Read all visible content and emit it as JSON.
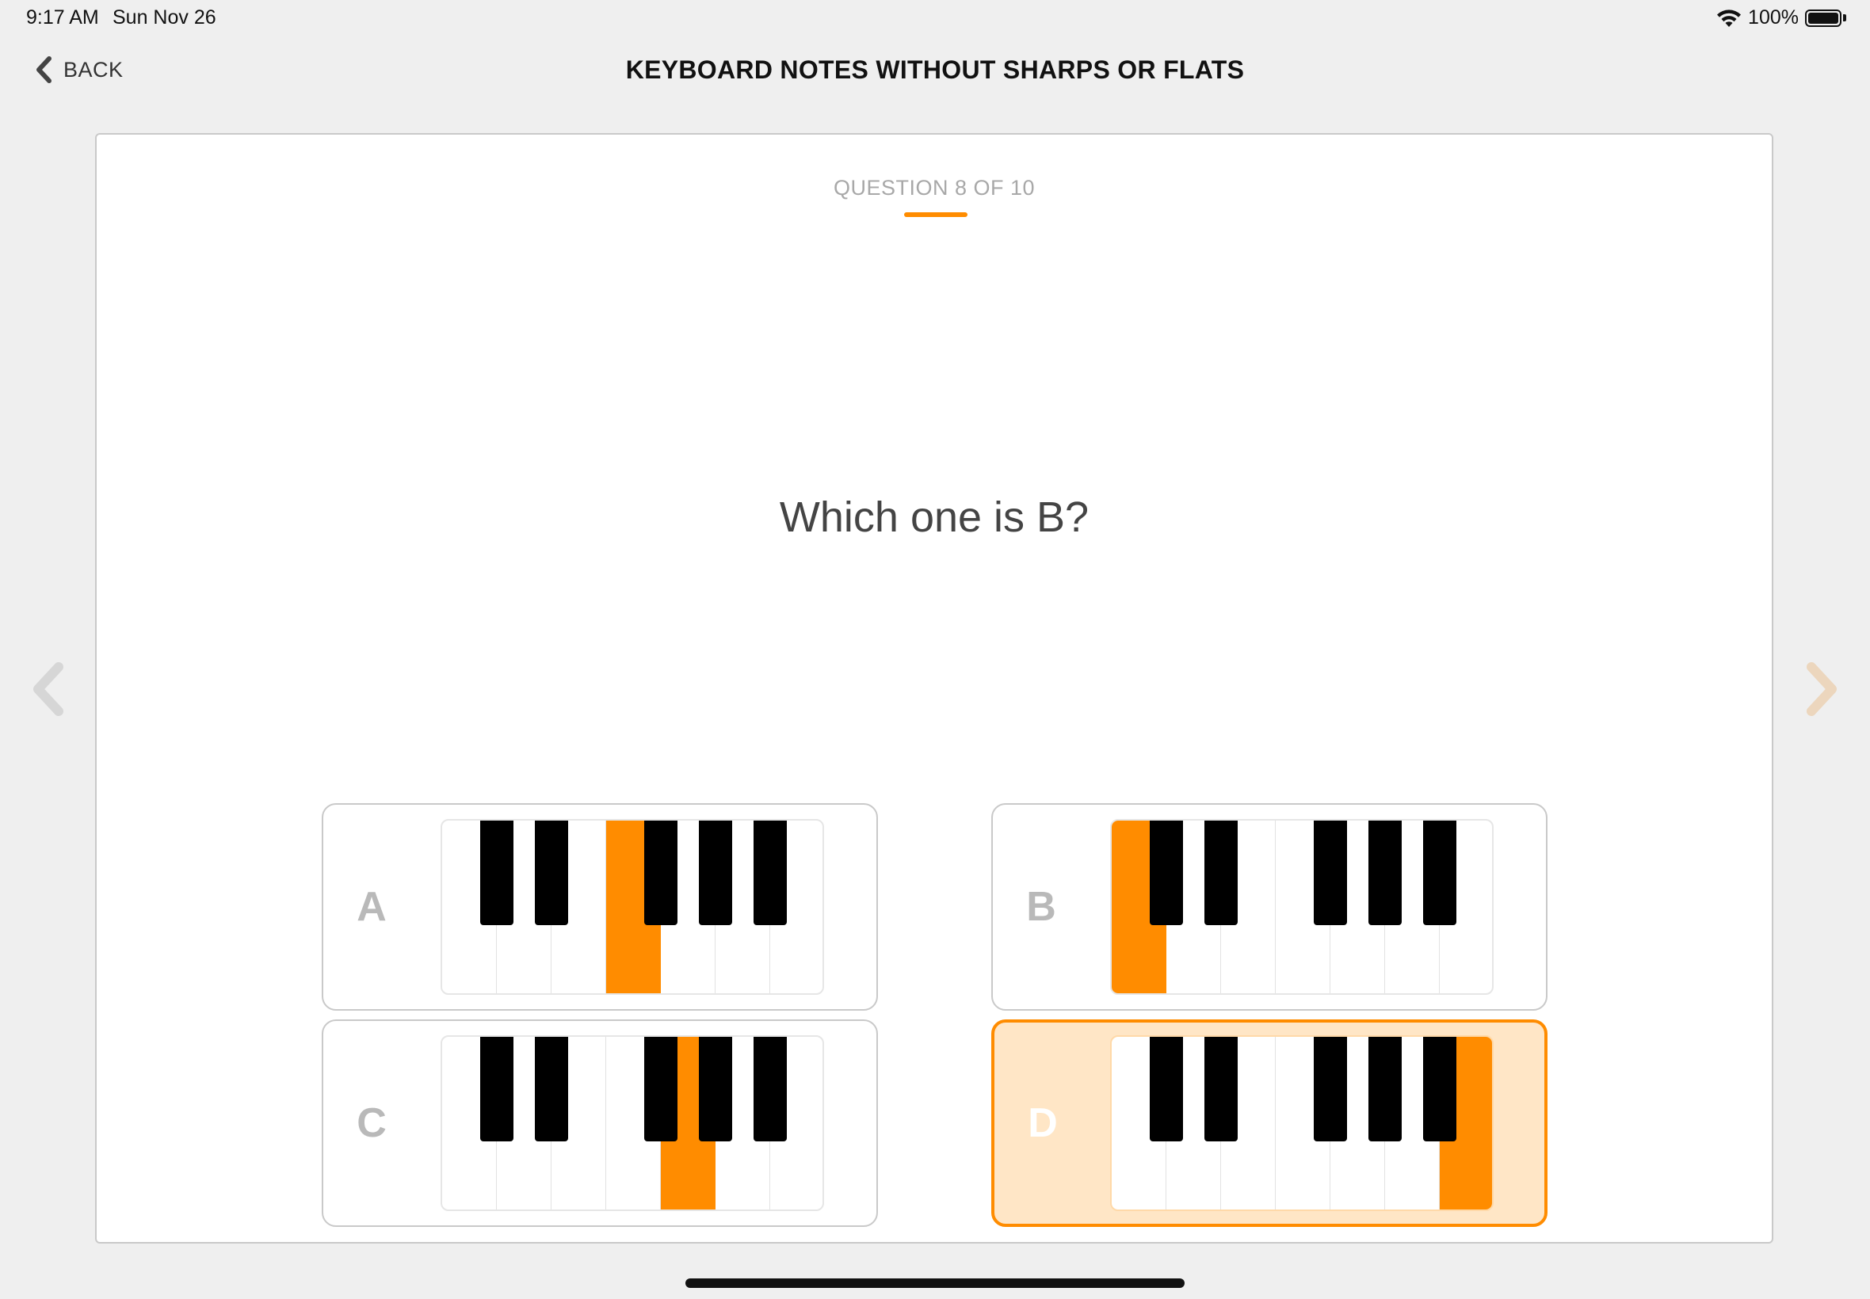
{
  "status": {
    "time": "9:17 AM",
    "date": "Sun Nov 26",
    "battery": "100%",
    "icons": [
      "wifi-icon",
      "battery-icon"
    ]
  },
  "nav": {
    "back_label": "BACK",
    "title": "KEYBOARD NOTES WITHOUT SHARPS OR FLATS"
  },
  "quiz": {
    "counter": "QUESTION 8 OF 10",
    "question": "Which one is B?",
    "options": [
      {
        "letter": "A",
        "highlighted_white_key": 4,
        "selected": false
      },
      {
        "letter": "B",
        "highlighted_white_key": 1,
        "selected": false
      },
      {
        "letter": "C",
        "highlighted_white_key": 5,
        "selected": false
      },
      {
        "letter": "D",
        "highlighted_white_key": 7,
        "selected": true
      }
    ]
  },
  "colors": {
    "accent": "#ff8c00",
    "selected_bg": "#ffe6c6",
    "background": "#efefef"
  }
}
